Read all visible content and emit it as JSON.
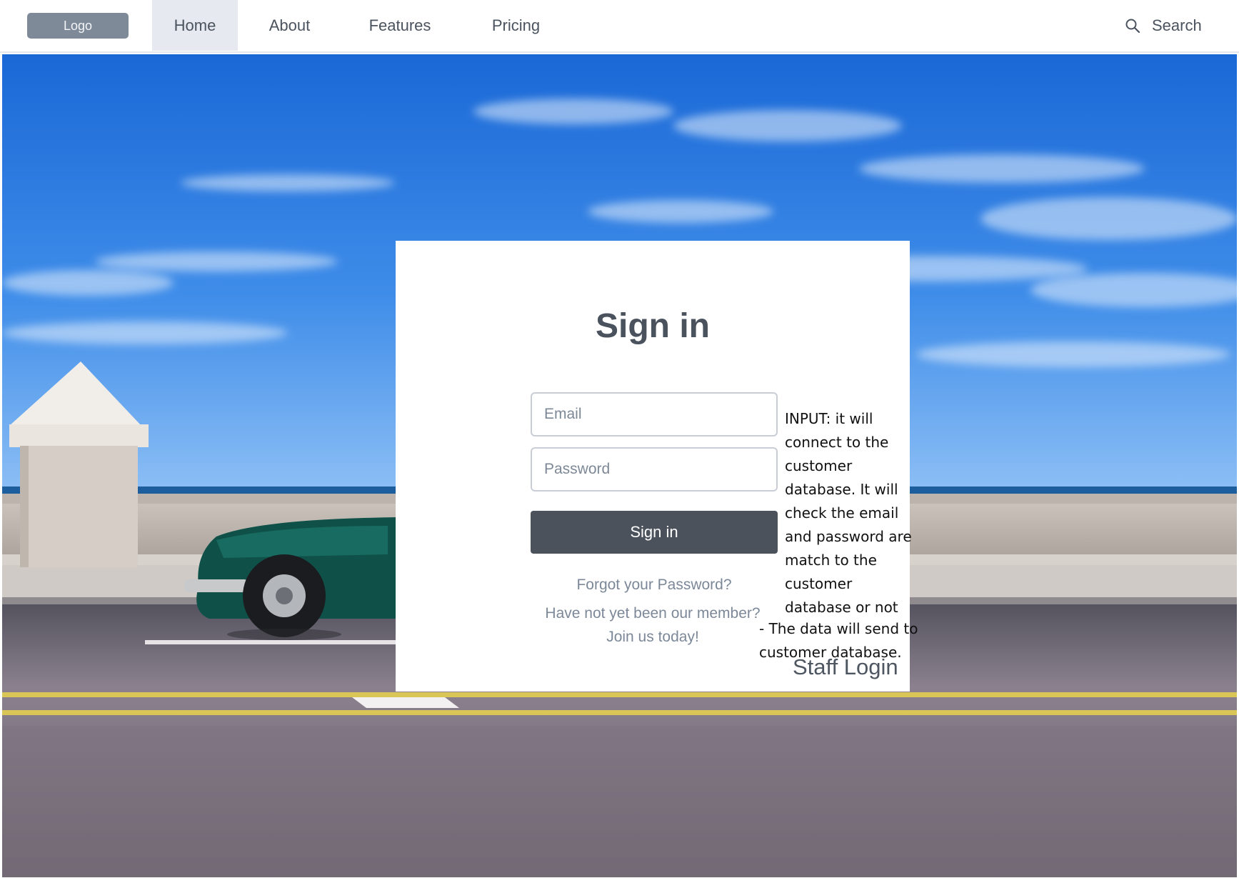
{
  "navbar": {
    "logo": "Logo",
    "items": [
      {
        "label": "Home",
        "active": true
      },
      {
        "label": "About",
        "active": false
      },
      {
        "label": "Features",
        "active": false
      },
      {
        "label": "Pricing",
        "active": false
      }
    ],
    "search_label": "Search"
  },
  "signin": {
    "title": "Sign in",
    "email_placeholder": "Email",
    "password_placeholder": "Password",
    "button_label": "Sign in",
    "forgot_link": "Forgot your Password?",
    "member_text": "Have not yet been our member?",
    "join_link": "Join us today!",
    "staff_login": "Staff Login"
  },
  "annotation": {
    "text": "INPUT: it will connect to the customer database. It will check the email and password are match to the customer database or not",
    "text_2": "- The data will send to customer database."
  },
  "colors": {
    "logo_bg": "#7f8a99",
    "active_nav_bg": "#e6e9f0",
    "button_bg": "#4b525c",
    "link_text": "#7c8898"
  },
  "icons": {
    "search": "search-icon"
  }
}
